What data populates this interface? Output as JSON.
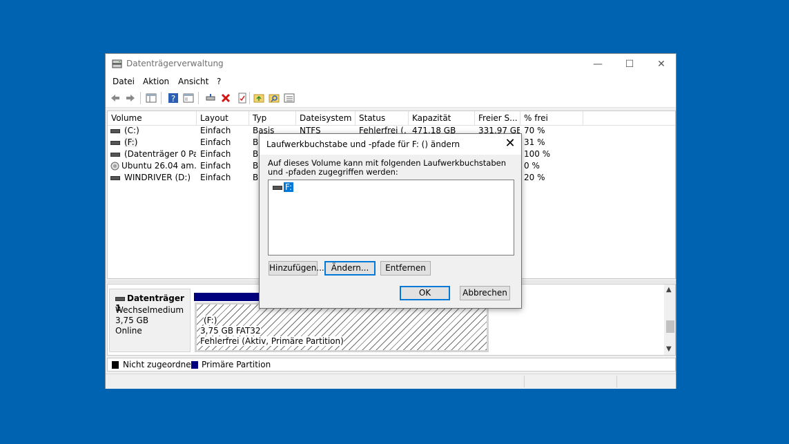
{
  "window": {
    "title": "Datenträgerverwaltung",
    "controls": {
      "minimize": "—",
      "maximize": "☐",
      "close": "✕"
    }
  },
  "menu": [
    "Datei",
    "Aktion",
    "Ansicht",
    "?"
  ],
  "toolbar_icons": [
    "back-arrow-icon",
    "forward-arrow-icon",
    "console-tree-icon",
    "help-icon",
    "properties-icon",
    "connect-disk-icon",
    "delete-icon",
    "checklist-icon",
    "folder-up-icon",
    "folder-search-icon",
    "list-view-icon"
  ],
  "volume_list": {
    "columns": [
      "Volume",
      "Layout",
      "Typ",
      "Dateisystem",
      "Status",
      "Kapazität",
      "Freier S...",
      "% frei"
    ],
    "rows": [
      {
        "volume": "(C:)",
        "layout": "Einfach",
        "typ": "Basis",
        "fs": "NTFS",
        "status": "Fehlerfrei (...",
        "cap": "471,18 GB",
        "free": "331,97 GB",
        "pct": "70 %"
      },
      {
        "volume": "(F:)",
        "layout": "Einfach",
        "typ": "Ba",
        "fs": "",
        "status": "",
        "cap": "",
        "free": "",
        "pct": "31 %"
      },
      {
        "volume": "(Datenträger 0 Par...",
        "layout": "Einfach",
        "typ": "Ba",
        "fs": "",
        "status": "",
        "cap": "",
        "free": "",
        "pct": "100 %"
      },
      {
        "volume": "Ubuntu 26.04 am...",
        "layout": "Einfach",
        "typ": "Ba",
        "fs": "",
        "status": "",
        "cap": "",
        "free": "",
        "pct": "0 %"
      },
      {
        "volume": "WINDRIVER (D:)",
        "layout": "Einfach",
        "typ": "Ba",
        "fs": "",
        "status": "",
        "cap": "",
        "free": "",
        "pct": "20 %"
      }
    ]
  },
  "disk": {
    "name": "Datenträger 1",
    "type": "Wechselmedium",
    "size": "3,75 GB",
    "state": "Online",
    "partition": {
      "label": "(F:)",
      "size_fs": "3,75 GB FAT32",
      "status": "Fehlerfrei (Aktiv, Primäre Partition)"
    }
  },
  "legend": {
    "unallocated": "Nicht zugeordnet",
    "primary": "Primäre Partition",
    "unallocated_color": "#000000",
    "primary_color": "#00007f"
  },
  "dialog": {
    "title": "Laufwerkbuchstabe und -pfade für F: () ändern",
    "description": "Auf dieses Volume kann mit folgenden Laufwerkbuchstaben und -pfaden zugegriffen werden:",
    "list_item": "F:",
    "buttons": {
      "add": "Hinzufügen...",
      "change": "Ändern...",
      "remove": "Entfernen",
      "ok": "OK",
      "cancel": "Abbrechen"
    },
    "selection_color": "#0078d7"
  }
}
